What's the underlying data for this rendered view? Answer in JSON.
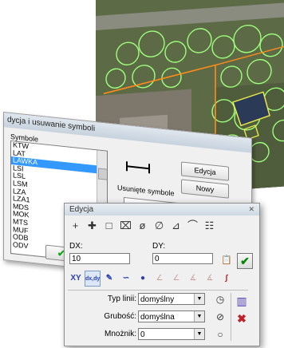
{
  "symbols_window": {
    "title": "dycja i usuwanie symboli",
    "list_label": "Symbole",
    "items": [
      "KTW",
      "LAT",
      "LAWKA",
      "LSI",
      "LSL",
      "LSM",
      "LZA",
      "LZA1",
      "MDS",
      "MOK",
      "MTS",
      "MUF",
      "ODB",
      "ODV"
    ],
    "selected": "LAWKA",
    "removed_label": "Usunięte symbole",
    "edit_button": "Edycja",
    "new_button": "Nowy"
  },
  "edit_window": {
    "title": "Edycja",
    "close": "✕",
    "dx_label": "DX:",
    "dx_value": "10",
    "dy_label": "DY:",
    "dy_value": "0",
    "line_type_label": "Typ linii:",
    "line_type_value": "domyślny",
    "thickness_label": "Grubość:",
    "thickness_value": "domyślna",
    "multiplier_label": "Mnożnik:",
    "multiplier_value": "0",
    "xy_label": "XY",
    "dxdy_label": "dx,dy"
  },
  "colors": {
    "accent_selection": "#3399ff",
    "ok_green": "#008800",
    "delete_red": "#c0202a"
  }
}
